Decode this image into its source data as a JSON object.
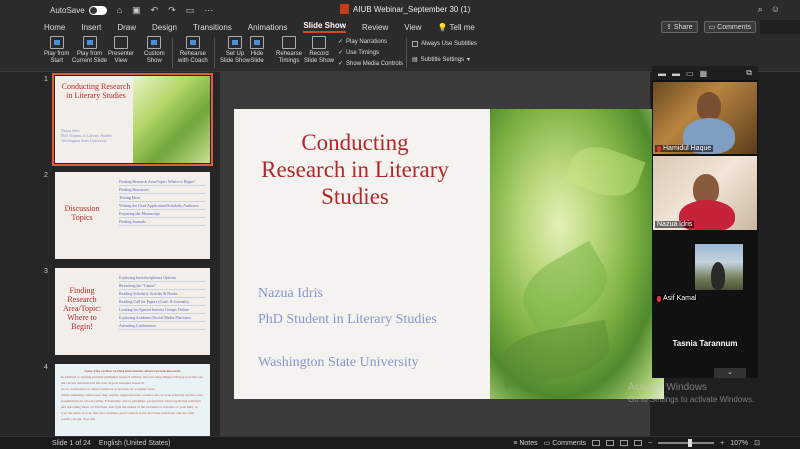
{
  "titlebar": {
    "autosave_label": "AutoSave",
    "doc_title": "AIUB Webinar_September 30 (1)"
  },
  "menu": {
    "tabs": [
      "Home",
      "Insert",
      "Draw",
      "Design",
      "Transitions",
      "Animations",
      "Slide Show",
      "Review",
      "View"
    ],
    "tell_me": "Tell me",
    "share": "Share",
    "comments": "Comments"
  },
  "ribbon": {
    "play_start": [
      "Play from",
      "Start"
    ],
    "play_current": [
      "Play from",
      "Current Slide"
    ],
    "presenter": [
      "Presenter",
      "View"
    ],
    "custom": [
      "Custom",
      "Show"
    ],
    "rehearse_coach": [
      "Rehearse",
      "with Coach"
    ],
    "setup": [
      "Set Up",
      "Slide Show"
    ],
    "hide": [
      "Hide",
      "Slide"
    ],
    "rehearse_timings": [
      "Rehearse",
      "Timings"
    ],
    "record": [
      "Record",
      "Slide Show"
    ],
    "play_narrations": "Play Narrations",
    "use_timings": "Use Timings",
    "show_media": "Show Media Controls",
    "always_subtitles": "Always Use Subtitles",
    "subtitle_settings": "Subtitle Settings"
  },
  "thumbnails": {
    "s1": {
      "num": "1",
      "title": "Conducting Research in Literary Studies",
      "lines": [
        "Nazua Idris",
        "PhD Student in Literary Studies",
        "Washington State University"
      ]
    },
    "s2": {
      "num": "2",
      "title": "Discussion Topics",
      "items": [
        "Finding Research Area/Topic: Where to Begin?",
        "Finding Resources",
        "Testing Ideas",
        "Writing the Grad Application/Scholarly Audience",
        "Preparing the Manuscript",
        "Finding Journals"
      ]
    },
    "s3": {
      "num": "3",
      "title": "Finding Research Area/Topic: Where to Begin!",
      "items": [
        "Exploring Interdisciplinary Options",
        "Revisiting the \"Canon\"",
        "Reading Scholarly Articles & Books",
        "Reading Call for Papers (Conf. & Journals)",
        "Looking for Special Interest Groups Online",
        "Exploring Academic/Social Media Platforms",
        "Attending Conferences"
      ]
    },
    "s4": {
      "num": "4",
      "title": "Some Tips on How to Find Information about Current Research",
      "lines": [
        "In addition to reading recently published research articles, the following things will help you find out the current discussion in the area of your intended research:",
        "Go to conferences or attend webinars or lectures on a regular basis.",
        "While attending conferences may require registration fee, another one, or even scholarly lectures and presentations in a book online. Fortunately, due to pandemic, people have been organizing webinars and uploading those on YouTube. Just type the names of the webinars or scholars or your field, or type the name of your field (for example, postcolonial) in the YouTube search bar and see what results you get. You will"
      ]
    }
  },
  "slide": {
    "title": "Conducting Research in Literary Studies",
    "name": "Nazua Idris",
    "role": "PhD Student in Literary Studies",
    "university": "Washington State University"
  },
  "participants": {
    "p1": "Hamidul Haque",
    "p2": "Nazua Idris",
    "p3": "Asif Kamal",
    "p4": "Tasnia Tarannum"
  },
  "watermark": {
    "line1": "Activate Windows",
    "line2": "Go to Settings to activate Windows."
  },
  "status": {
    "slide_of": "Slide 1 of 24",
    "language": "English (United States)",
    "notes": "Notes",
    "comments": "Comments",
    "zoom": "107%"
  },
  "colors": {
    "title_red": "#b0282a",
    "subtitle_blue": "#8896cc",
    "accent": "#d04a2a"
  }
}
